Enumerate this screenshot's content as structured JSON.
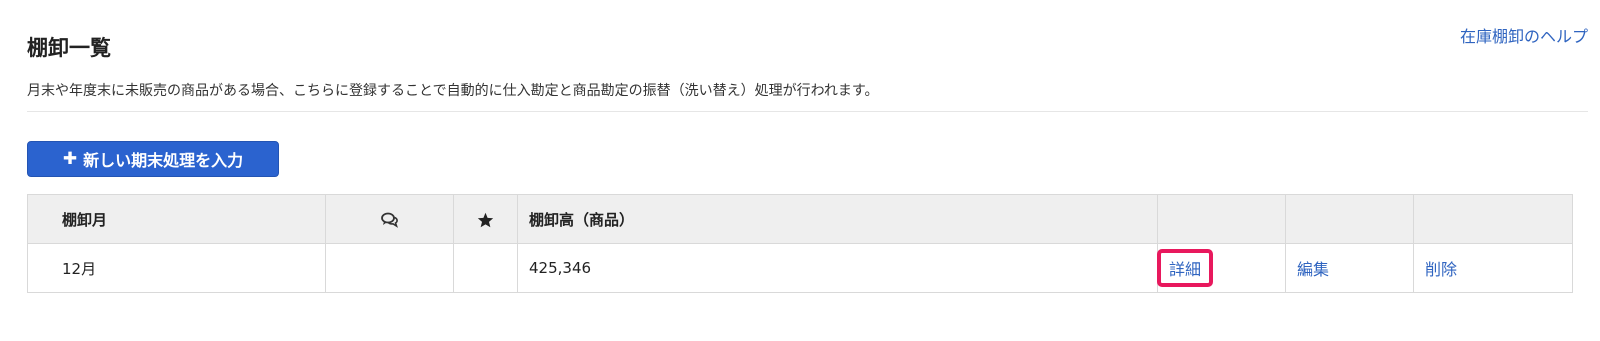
{
  "header": {
    "title": "棚卸一覧",
    "help_link": "在庫棚卸のヘルプ",
    "description": "月末や年度末に未販売の商品がある場合、こちらに登録することで自動的に仕入勘定と商品勘定の振替（洗い替え）処理が行われます。"
  },
  "toolbar": {
    "new_button_label": "新しい期末処理を入力",
    "new_button_icon": "plus-icon"
  },
  "table": {
    "columns": {
      "month": "棚卸月",
      "comment_icon": "comment-icon",
      "star_icon": "star-icon",
      "amount": "棚卸高（商品）"
    },
    "rows": [
      {
        "month": "12月",
        "amount": "425,346",
        "detail": "詳細",
        "edit": "編集",
        "delete": "削除"
      }
    ]
  },
  "colors": {
    "link": "#2f64c0",
    "primary_button": "#2b63cf",
    "highlight": "#e8185d",
    "header_bg": "#efefef"
  }
}
